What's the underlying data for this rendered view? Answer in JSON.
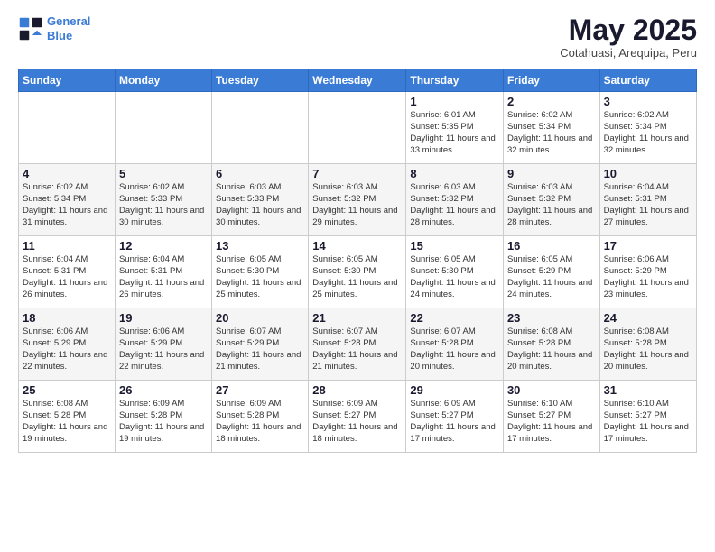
{
  "logo": {
    "line1": "General",
    "line2": "Blue"
  },
  "title": "May 2025",
  "subtitle": "Cotahuasi, Arequipa, Peru",
  "weekdays": [
    "Sunday",
    "Monday",
    "Tuesday",
    "Wednesday",
    "Thursday",
    "Friday",
    "Saturday"
  ],
  "weeks": [
    [
      {
        "day": "",
        "info": ""
      },
      {
        "day": "",
        "info": ""
      },
      {
        "day": "",
        "info": ""
      },
      {
        "day": "",
        "info": ""
      },
      {
        "day": "1",
        "info": "Sunrise: 6:01 AM\nSunset: 5:35 PM\nDaylight: 11 hours\nand 33 minutes."
      },
      {
        "day": "2",
        "info": "Sunrise: 6:02 AM\nSunset: 5:34 PM\nDaylight: 11 hours\nand 32 minutes."
      },
      {
        "day": "3",
        "info": "Sunrise: 6:02 AM\nSunset: 5:34 PM\nDaylight: 11 hours\nand 32 minutes."
      }
    ],
    [
      {
        "day": "4",
        "info": "Sunrise: 6:02 AM\nSunset: 5:34 PM\nDaylight: 11 hours\nand 31 minutes."
      },
      {
        "day": "5",
        "info": "Sunrise: 6:02 AM\nSunset: 5:33 PM\nDaylight: 11 hours\nand 30 minutes."
      },
      {
        "day": "6",
        "info": "Sunrise: 6:03 AM\nSunset: 5:33 PM\nDaylight: 11 hours\nand 30 minutes."
      },
      {
        "day": "7",
        "info": "Sunrise: 6:03 AM\nSunset: 5:32 PM\nDaylight: 11 hours\nand 29 minutes."
      },
      {
        "day": "8",
        "info": "Sunrise: 6:03 AM\nSunset: 5:32 PM\nDaylight: 11 hours\nand 28 minutes."
      },
      {
        "day": "9",
        "info": "Sunrise: 6:03 AM\nSunset: 5:32 PM\nDaylight: 11 hours\nand 28 minutes."
      },
      {
        "day": "10",
        "info": "Sunrise: 6:04 AM\nSunset: 5:31 PM\nDaylight: 11 hours\nand 27 minutes."
      }
    ],
    [
      {
        "day": "11",
        "info": "Sunrise: 6:04 AM\nSunset: 5:31 PM\nDaylight: 11 hours\nand 26 minutes."
      },
      {
        "day": "12",
        "info": "Sunrise: 6:04 AM\nSunset: 5:31 PM\nDaylight: 11 hours\nand 26 minutes."
      },
      {
        "day": "13",
        "info": "Sunrise: 6:05 AM\nSunset: 5:30 PM\nDaylight: 11 hours\nand 25 minutes."
      },
      {
        "day": "14",
        "info": "Sunrise: 6:05 AM\nSunset: 5:30 PM\nDaylight: 11 hours\nand 25 minutes."
      },
      {
        "day": "15",
        "info": "Sunrise: 6:05 AM\nSunset: 5:30 PM\nDaylight: 11 hours\nand 24 minutes."
      },
      {
        "day": "16",
        "info": "Sunrise: 6:05 AM\nSunset: 5:29 PM\nDaylight: 11 hours\nand 24 minutes."
      },
      {
        "day": "17",
        "info": "Sunrise: 6:06 AM\nSunset: 5:29 PM\nDaylight: 11 hours\nand 23 minutes."
      }
    ],
    [
      {
        "day": "18",
        "info": "Sunrise: 6:06 AM\nSunset: 5:29 PM\nDaylight: 11 hours\nand 22 minutes."
      },
      {
        "day": "19",
        "info": "Sunrise: 6:06 AM\nSunset: 5:29 PM\nDaylight: 11 hours\nand 22 minutes."
      },
      {
        "day": "20",
        "info": "Sunrise: 6:07 AM\nSunset: 5:29 PM\nDaylight: 11 hours\nand 21 minutes."
      },
      {
        "day": "21",
        "info": "Sunrise: 6:07 AM\nSunset: 5:28 PM\nDaylight: 11 hours\nand 21 minutes."
      },
      {
        "day": "22",
        "info": "Sunrise: 6:07 AM\nSunset: 5:28 PM\nDaylight: 11 hours\nand 20 minutes."
      },
      {
        "day": "23",
        "info": "Sunrise: 6:08 AM\nSunset: 5:28 PM\nDaylight: 11 hours\nand 20 minutes."
      },
      {
        "day": "24",
        "info": "Sunrise: 6:08 AM\nSunset: 5:28 PM\nDaylight: 11 hours\nand 20 minutes."
      }
    ],
    [
      {
        "day": "25",
        "info": "Sunrise: 6:08 AM\nSunset: 5:28 PM\nDaylight: 11 hours\nand 19 minutes."
      },
      {
        "day": "26",
        "info": "Sunrise: 6:09 AM\nSunset: 5:28 PM\nDaylight: 11 hours\nand 19 minutes."
      },
      {
        "day": "27",
        "info": "Sunrise: 6:09 AM\nSunset: 5:28 PM\nDaylight: 11 hours\nand 18 minutes."
      },
      {
        "day": "28",
        "info": "Sunrise: 6:09 AM\nSunset: 5:27 PM\nDaylight: 11 hours\nand 18 minutes."
      },
      {
        "day": "29",
        "info": "Sunrise: 6:09 AM\nSunset: 5:27 PM\nDaylight: 11 hours\nand 17 minutes."
      },
      {
        "day": "30",
        "info": "Sunrise: 6:10 AM\nSunset: 5:27 PM\nDaylight: 11 hours\nand 17 minutes."
      },
      {
        "day": "31",
        "info": "Sunrise: 6:10 AM\nSunset: 5:27 PM\nDaylight: 11 hours\nand 17 minutes."
      }
    ]
  ]
}
